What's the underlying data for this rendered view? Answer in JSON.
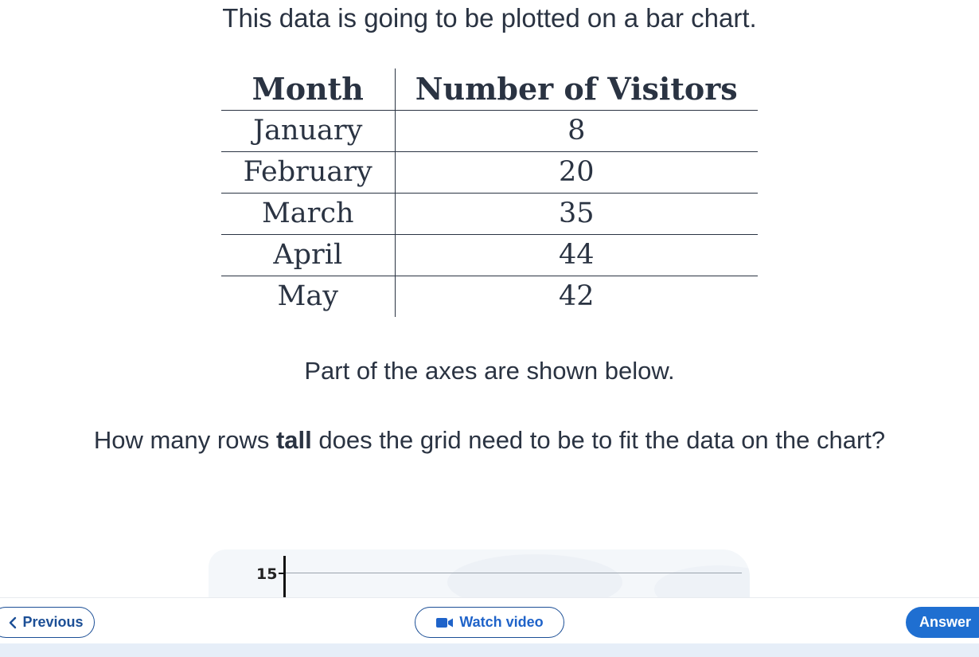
{
  "intro_text": "This data is going to be plotted on a bar chart.",
  "table": {
    "headers": [
      "Month",
      "Number of Visitors"
    ],
    "rows": [
      {
        "month": "January",
        "visitors": "8"
      },
      {
        "month": "February",
        "visitors": "20"
      },
      {
        "month": "March",
        "visitors": "35"
      },
      {
        "month": "April",
        "visitors": "44"
      },
      {
        "month": "May",
        "visitors": "42"
      }
    ]
  },
  "axes_text": "Part of the axes are shown below.",
  "question": {
    "before": "How many rows ",
    "bold": "tall",
    "after": " does the grid need to be to fit the data on the chart?"
  },
  "chart": {
    "y_tick_label": "15"
  },
  "footer": {
    "previous_label": "Previous",
    "watch_label": "Watch video",
    "answer_label": "Answer"
  },
  "colors": {
    "accent": "#1f6fd1",
    "outline": "#1c4f96",
    "text": "#2a3342"
  },
  "icons": {
    "previous": "chevron-left-icon",
    "watch": "video-camera-icon"
  }
}
